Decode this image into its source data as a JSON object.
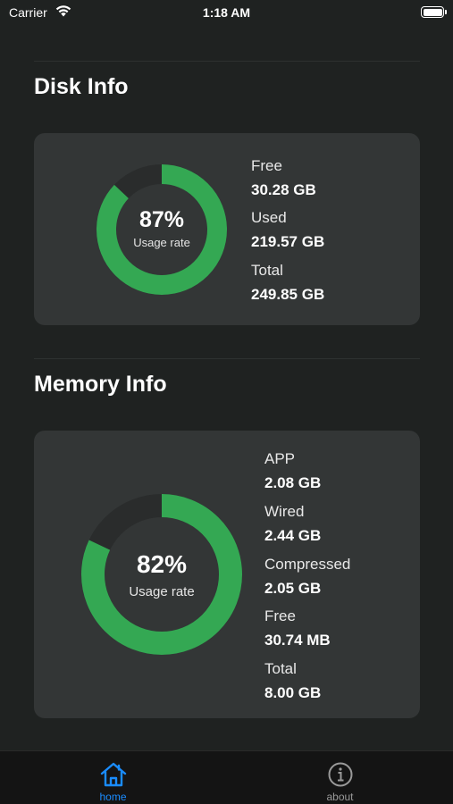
{
  "status": {
    "carrier": "Carrier",
    "time": "1:18 AM"
  },
  "disk": {
    "title": "Disk Info",
    "percent": "87%",
    "usage_fraction": 0.87,
    "caption": "Usage rate",
    "free_label": "Free",
    "free_value": "30.28 GB",
    "used_label": "Used",
    "used_value": "219.57 GB",
    "total_label": "Total",
    "total_value": "249.85 GB"
  },
  "memory": {
    "title": "Memory Info",
    "percent": "82%",
    "usage_fraction": 0.82,
    "caption": "Usage rate",
    "app_label": "APP",
    "app_value": "2.08 GB",
    "wired_label": "Wired",
    "wired_value": "2.44 GB",
    "compressed_label": "Compressed",
    "compressed_value": "2.05 GB",
    "free_label": "Free",
    "free_value": "30.74 MB",
    "total_label": "Total",
    "total_value": "8.00 GB"
  },
  "tabs": [
    {
      "label": "home",
      "icon": "home-icon",
      "active": true
    },
    {
      "label": "about",
      "icon": "info-icon",
      "active": false
    }
  ],
  "colors": {
    "ring": "#34a853",
    "ring_track": "#2a2c2c",
    "active_tab": "#1a8cff",
    "inactive_tab": "#9a9a9a"
  }
}
